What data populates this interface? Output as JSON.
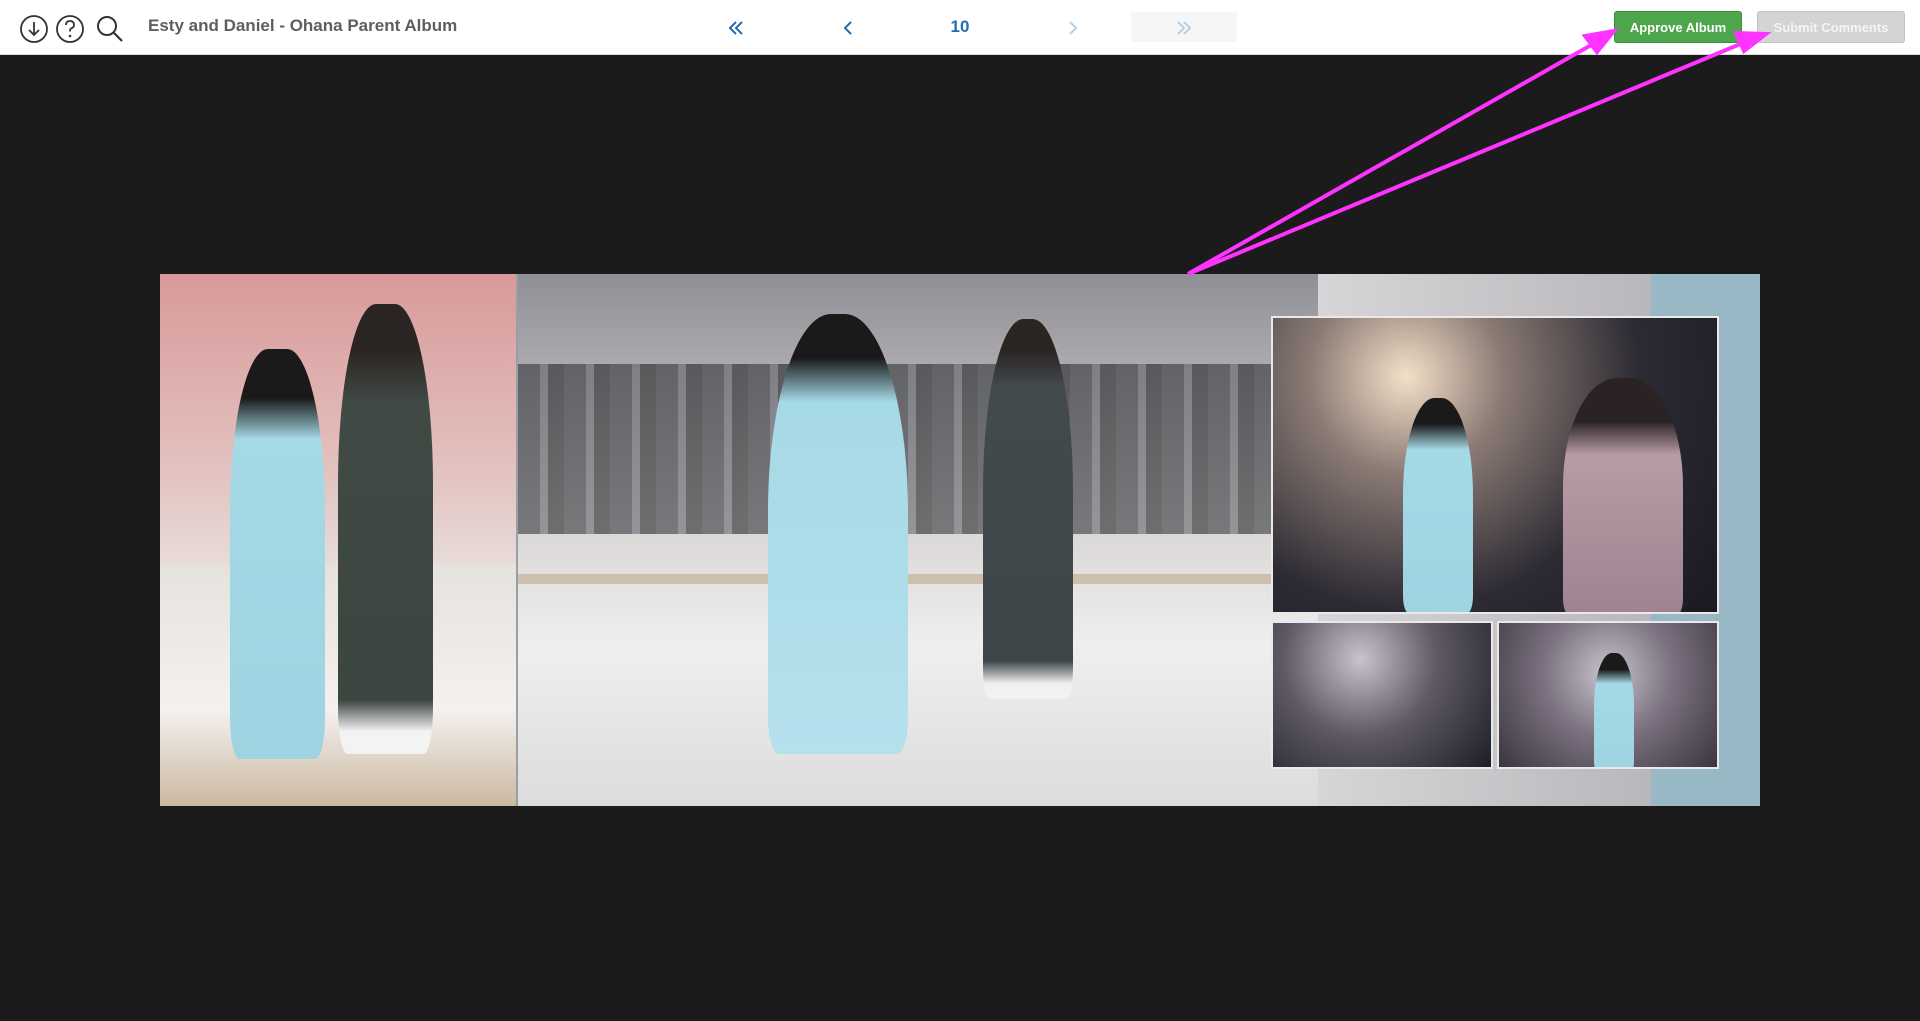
{
  "toolbar": {
    "download_icon": "download-icon",
    "help_icon": "help-icon",
    "search_icon": "search-icon",
    "album_title": "Esty and Daniel - Ohana Parent Album",
    "first_icon": "double-chevron-left-icon",
    "prev_icon": "chevron-left-icon",
    "page_number": "10",
    "next_icon": "chevron-right-icon",
    "last_icon": "double-chevron-right-icon",
    "approve_label": "Approve Album",
    "submit_label": "Submit Comments"
  },
  "colors": {
    "accent_blue": "#1f6fb0",
    "approve_green": "#4ea64c",
    "submit_disabled": "#d4d4d4",
    "background": "#1b1b1b",
    "annotation_arrow": "#ff33ff"
  }
}
